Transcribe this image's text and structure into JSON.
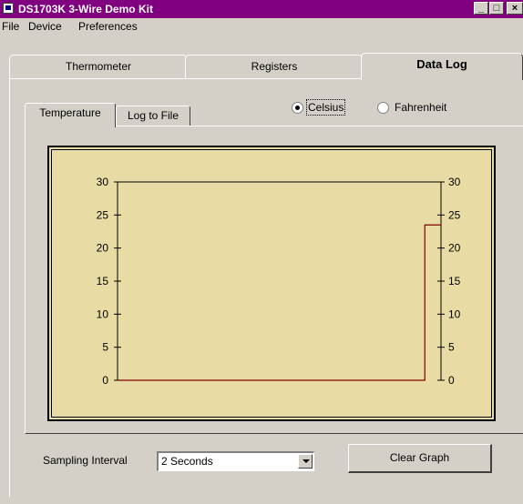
{
  "window": {
    "title": "DS1703K 3-Wire Demo Kit"
  },
  "menu": {
    "items": [
      "File",
      "Device",
      "Preferences"
    ]
  },
  "tabs": [
    {
      "label": "Thermometer",
      "active": false
    },
    {
      "label": "Registers",
      "active": false
    },
    {
      "label": "Data Log",
      "active": true
    }
  ],
  "inner_tabs": [
    {
      "label": "Temperature",
      "active": true
    },
    {
      "label": "Log to File",
      "active": false
    }
  ],
  "units": {
    "options": [
      {
        "label": "Celsius",
        "checked": true
      },
      {
        "label": "Fahrenheit",
        "checked": false
      }
    ]
  },
  "chart_data": {
    "type": "line",
    "title": "",
    "xlabel": "",
    "ylabel": "",
    "ylim": [
      0,
      30
    ],
    "yticks": [
      0,
      5,
      10,
      15,
      20,
      25,
      30
    ],
    "grid": false,
    "line_color": "#800000",
    "background_color": "#e8dca4",
    "series": [
      {
        "values": [
          0,
          0,
          0,
          0,
          0,
          0,
          0,
          0,
          0,
          0,
          0,
          0,
          0,
          0,
          0,
          0,
          0,
          0,
          0,
          23.5,
          23.5
        ]
      }
    ]
  },
  "controls": {
    "sampling_label": "Sampling Interval",
    "sampling_value": "2 Seconds",
    "clear_button": "Clear Graph"
  }
}
